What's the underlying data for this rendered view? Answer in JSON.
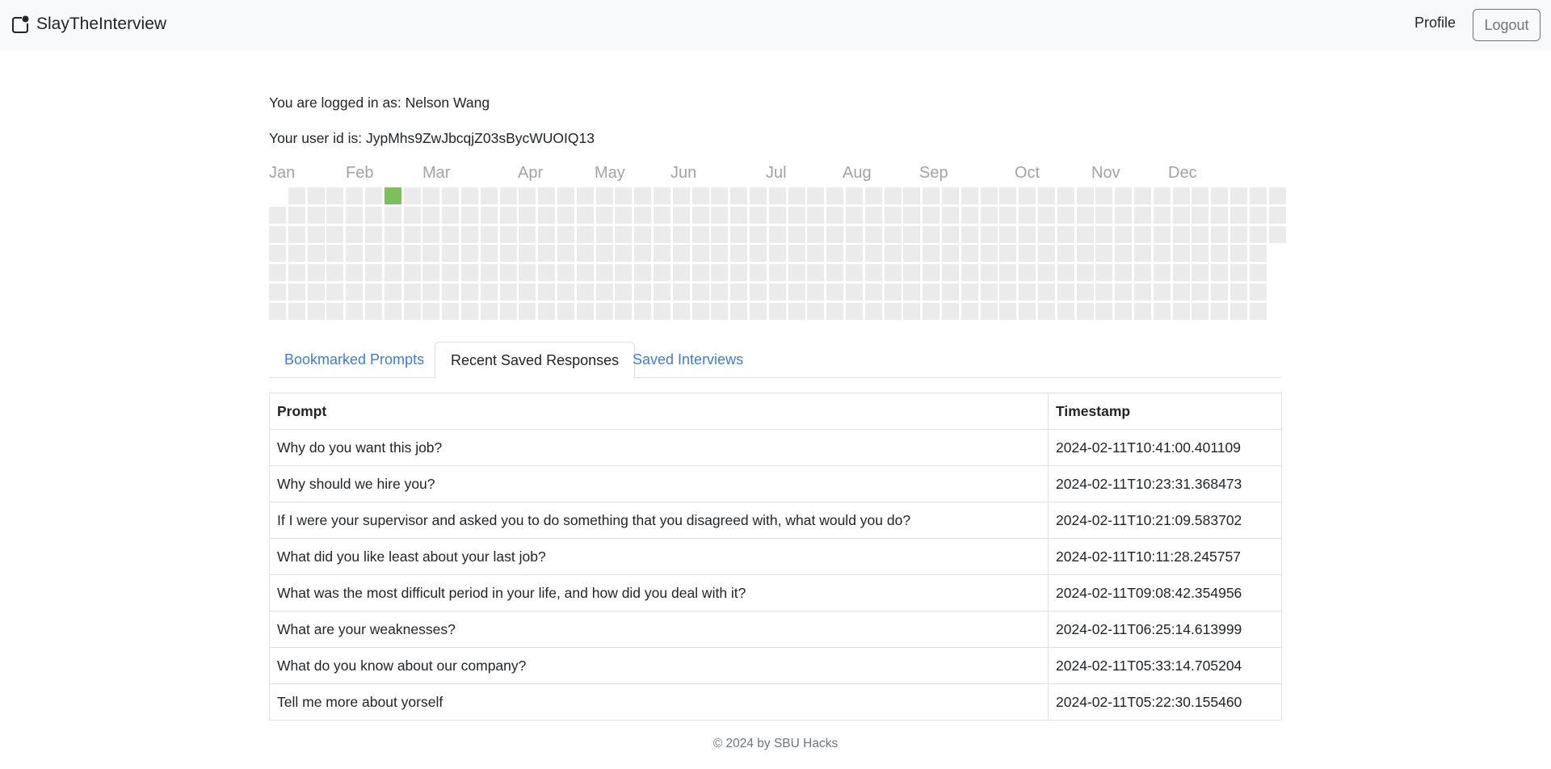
{
  "app": {
    "title": "SlayTheInterview",
    "nav_profile": "Profile",
    "logout_label": "Logout"
  },
  "user": {
    "logged_in_line": "You are logged in as: Nelson Wang",
    "user_id_line": "Your user id is: JypMhs9ZwJbcqjZ03sBycWUOIQ13"
  },
  "calendar": {
    "months": [
      "Jan",
      "Feb",
      "Mar",
      "Apr",
      "May",
      "Jun",
      "Jul",
      "Aug",
      "Sep",
      "Oct",
      "Nov",
      "Dec"
    ],
    "active_color": "#7cc05c",
    "empty_color": "#ebebeb",
    "active_days": [
      {
        "date": "2024-02-11",
        "count": 8
      }
    ]
  },
  "tabs": [
    {
      "label": "Bookmarked Prompts",
      "active": false
    },
    {
      "label": "Recent Saved Responses",
      "active": true
    },
    {
      "label": "Saved Interviews",
      "active": false
    }
  ],
  "table": {
    "headers": [
      "Prompt",
      "Timestamp"
    ],
    "rows": [
      {
        "prompt": "Why do you want this job?",
        "timestamp": "2024-02-11T10:41:00.401109"
      },
      {
        "prompt": "Why should we hire you?",
        "timestamp": "2024-02-11T10:23:31.368473"
      },
      {
        "prompt": "If I were your supervisor and asked you to do something that you disagreed with, what would you do?",
        "timestamp": "2024-02-11T10:21:09.583702"
      },
      {
        "prompt": "What did you like least about your last job?",
        "timestamp": "2024-02-11T10:11:28.245757"
      },
      {
        "prompt": "What was the most difficult period in your life, and how did you deal with it?",
        "timestamp": "2024-02-11T09:08:42.354956"
      },
      {
        "prompt": "What are your weaknesses?",
        "timestamp": "2024-02-11T06:25:14.613999"
      },
      {
        "prompt": "What do you know about our company?",
        "timestamp": "2024-02-11T05:33:14.705204"
      },
      {
        "prompt": "Tell me more about yorself",
        "timestamp": "2024-02-11T05:22:30.155460"
      }
    ]
  },
  "footer": "© 2024 by SBU Hacks"
}
